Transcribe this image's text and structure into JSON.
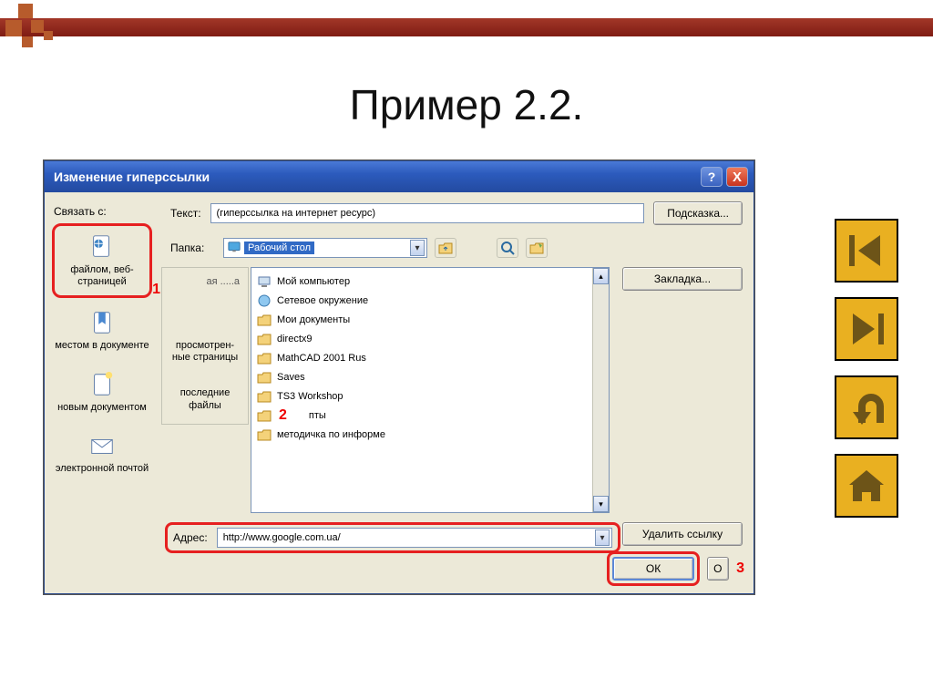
{
  "slide": {
    "title": "Пример 2.2."
  },
  "dialog": {
    "title": "Изменение гиперссылки",
    "help_symbol": "?",
    "close_symbol": "X",
    "link_with_label": "Связать с:",
    "linkbar": {
      "file_web": "файлом, веб-страницей",
      "place_in_doc": "местом в документе",
      "new_doc": "новым документом",
      "email": "электронной почтой"
    },
    "text_label": "Текст:",
    "text_value": "(гиперссылка на интернет ресурс)",
    "hint_button": "Подсказка...",
    "folder_label": "Папка:",
    "folder_value": "Рабочий стол",
    "places": {
      "current_ghost": "ая\n.....а",
      "viewed_pages": "просмотрен-ные страницы",
      "recent_files": "последние файлы"
    },
    "list_items": [
      "Мой компьютер",
      "Сетевое окружение",
      "Мои документы",
      "directx9",
      "MathCAD 2001 Rus",
      "Saves",
      "TS3 Workshop",
      "пты",
      "методичка по информе"
    ],
    "bookmark_button": "Закладка...",
    "address_label": "Адрес:",
    "address_value": "http://www.google.com.ua/",
    "remove_link_button": "Удалить ссылку",
    "ok_button": "ОК",
    "cancel_button": "О"
  },
  "callouts": {
    "one": "1",
    "two": "2",
    "three": "3"
  },
  "nav_icons": {
    "prev": "previous",
    "next": "next",
    "back": "back",
    "home": "home"
  }
}
